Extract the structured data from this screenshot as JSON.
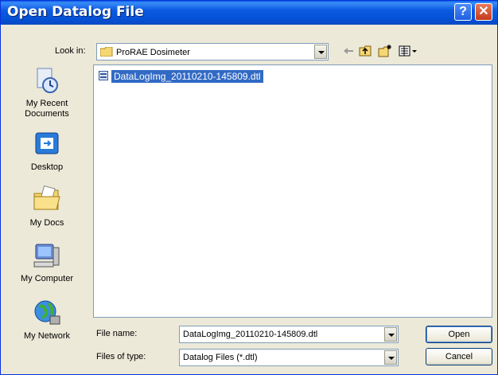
{
  "window": {
    "title": "Open Datalog File"
  },
  "lookin": {
    "label": "Look in:",
    "value": "ProRAE Dosimeter"
  },
  "places": [
    {
      "label": "My Recent Documents"
    },
    {
      "label": "Desktop"
    },
    {
      "label": "My Docs"
    },
    {
      "label": "My Computer"
    },
    {
      "label": "My Network"
    }
  ],
  "files": [
    {
      "name": "DataLogImg_20110210-145809.dtl"
    }
  ],
  "filename": {
    "label": "File name:",
    "value": "DataLogImg_20110210-145809.dtl"
  },
  "filetype": {
    "label": "Files of type:",
    "value": "Datalog Files (*.dtl)"
  },
  "buttons": {
    "open": "Open",
    "cancel": "Cancel"
  },
  "icons": {
    "help": "help-icon",
    "close": "close-icon"
  },
  "colors": {
    "titlebar": "#0a5fe6",
    "selection": "#316ac5",
    "close": "#c4391d"
  }
}
